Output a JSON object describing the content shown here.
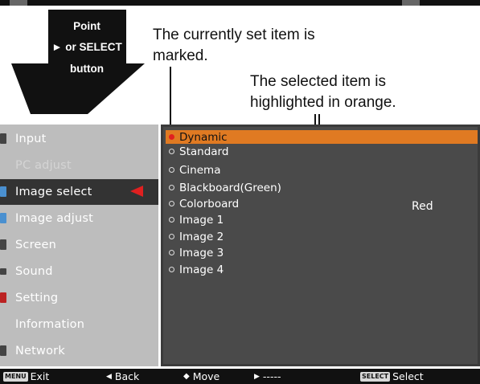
{
  "guide": {
    "button_label_line1": "Point",
    "button_label_line2": "► or SELECT",
    "button_label_line3": "button",
    "annotation_current_line1": "The currently set item is",
    "annotation_current_line2": "marked.",
    "annotation_selected_line1": "The selected item is",
    "annotation_selected_line2": "highlighted in orange."
  },
  "menu": {
    "items": [
      {
        "label": "Input",
        "icon": "input-icon"
      },
      {
        "label": "PC adjust",
        "icon": "pc-adjust-icon"
      },
      {
        "label": "Image select",
        "icon": "image-select-icon"
      },
      {
        "label": "Image adjust",
        "icon": "image-adjust-icon"
      },
      {
        "label": "Screen",
        "icon": "screen-icon"
      },
      {
        "label": "Sound",
        "icon": "sound-icon"
      },
      {
        "label": "Setting",
        "icon": "setting-icon"
      },
      {
        "label": "Information",
        "icon": "information-icon"
      },
      {
        "label": "Network",
        "icon": "network-icon"
      }
    ],
    "selected_index": 2
  },
  "options": {
    "items": [
      "Dynamic",
      "Standard",
      "Cinema",
      "Blackboard(Green)",
      "Colorboard",
      "Image 1",
      "Image 2",
      "Image 3",
      "Image 4"
    ],
    "current_index": 0,
    "highlight_index": 0,
    "colorboard_value": "Red",
    "highlight_color": "#e07a22",
    "marker_color": "#e02020"
  },
  "statusbar": {
    "exit_key": "MENU",
    "exit_label": "Exit",
    "back_symbol": "◀",
    "back_label": "Back",
    "move_symbol": "◆",
    "move_label": "Move",
    "next_symbol": "▶",
    "next_label": "-----",
    "select_key": "SELECT",
    "select_label": "Select"
  }
}
